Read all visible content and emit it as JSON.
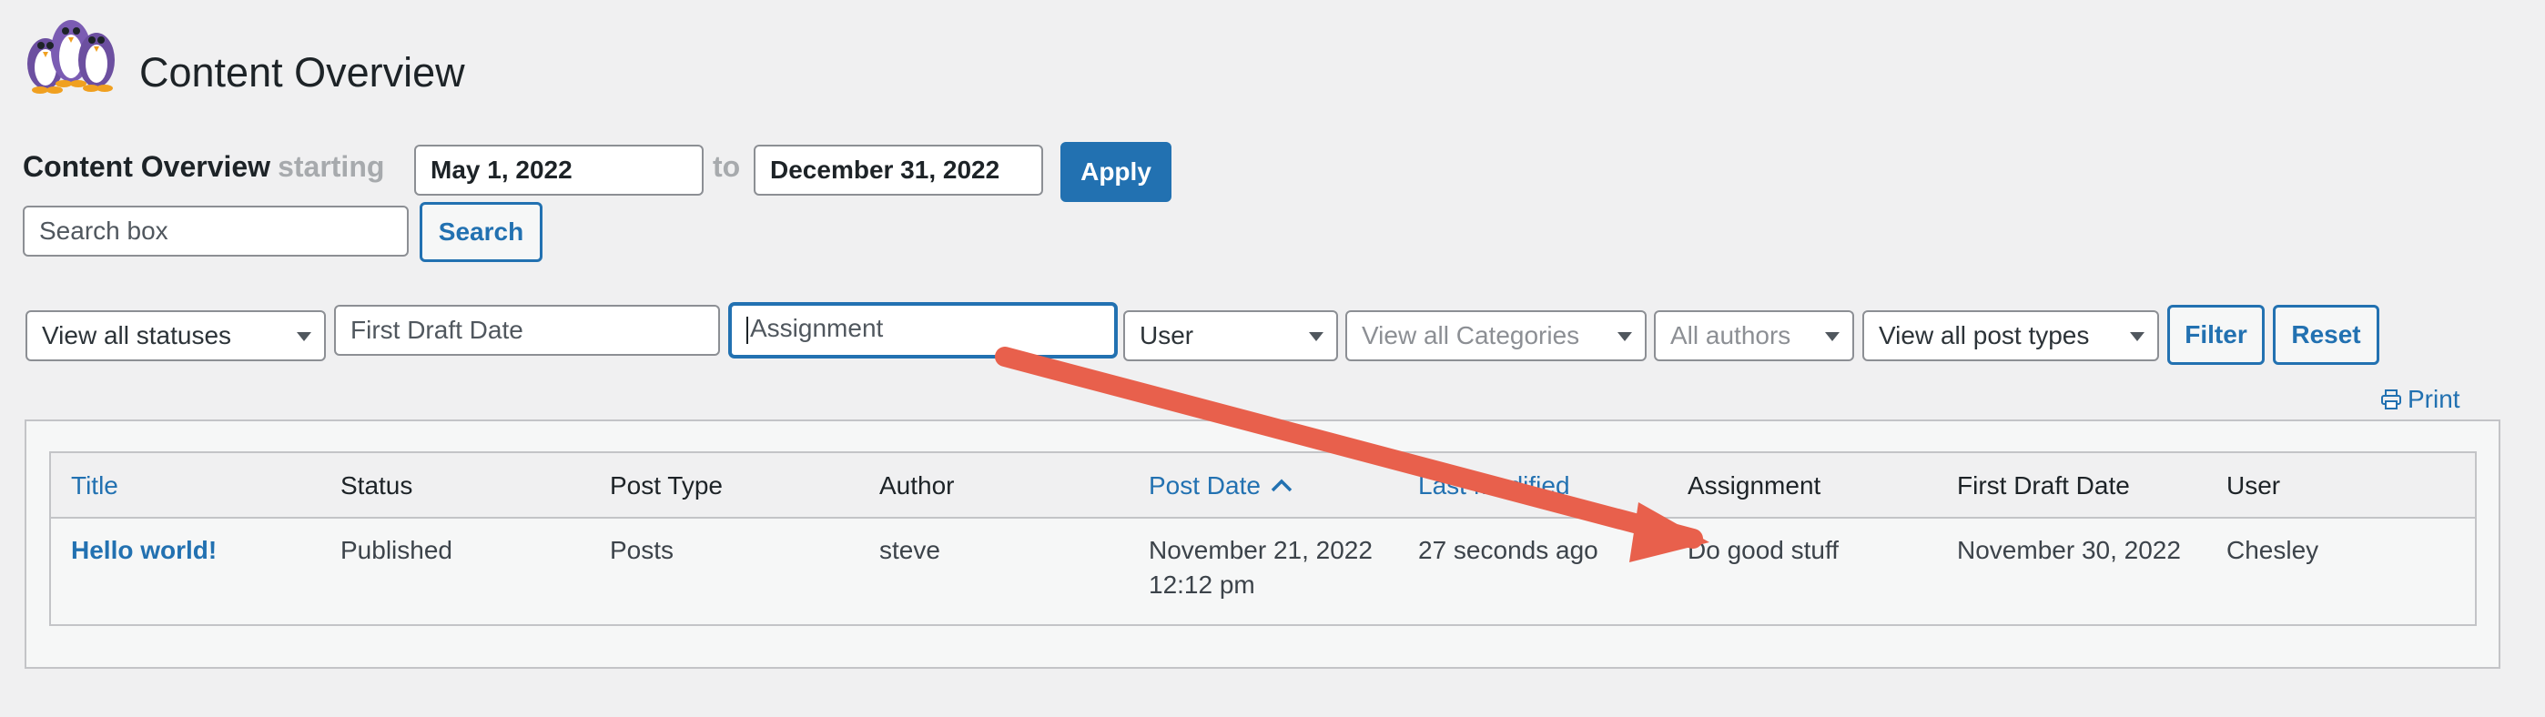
{
  "header": {
    "title": "Content Overview"
  },
  "range": {
    "title": "Content Overview",
    "starting_word": "starting",
    "start_date": "May 1, 2022",
    "to_word": "to",
    "end_date": "December 31, 2022",
    "apply_label": "Apply"
  },
  "search": {
    "placeholder": "Search box",
    "button_label": "Search"
  },
  "filters": {
    "status": "View all statuses",
    "first_draft_date": "First Draft Date",
    "assignment": "Assignment",
    "user": "User",
    "categories": "View all Categories",
    "authors": "All authors",
    "post_types": "View all post types",
    "filter_label": "Filter",
    "reset_label": "Reset"
  },
  "print_label": "Print",
  "table": {
    "columns": [
      "Title",
      "Status",
      "Post Type",
      "Author",
      "Post Date",
      "Last Modified",
      "Assignment",
      "First Draft Date",
      "User"
    ],
    "rows": [
      {
        "title": "Hello world!",
        "status": "Published",
        "post_type": "Posts",
        "author": "steve",
        "post_date_line1": "November 21, 2022",
        "post_date_line2": "12:12 pm",
        "last_modified": "27 seconds ago",
        "assignment": "Do good stuff",
        "first_draft_date": "November 30, 2022",
        "user": "Chesley"
      }
    ]
  },
  "colors": {
    "accent": "#2271b1",
    "annotation_arrow": "#e8604c"
  },
  "icons": {
    "logo": "penguins-logo",
    "print": "printer-icon",
    "sort": "chevron-up-icon"
  }
}
